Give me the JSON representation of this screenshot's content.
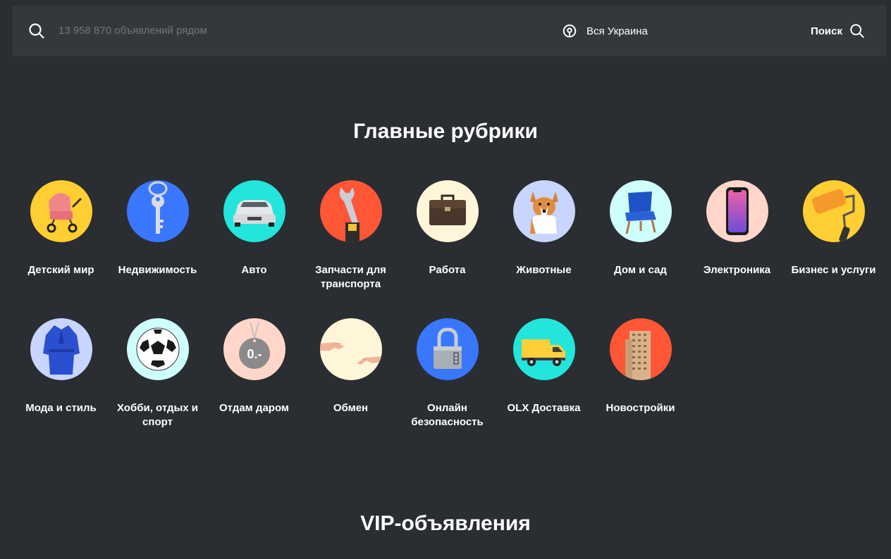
{
  "search": {
    "placeholder": "13 958 870 объявлений рядом",
    "location": "Вся Украина",
    "button_label": "Поиск",
    "icon": "search-icon",
    "location_icon": "map-pin-icon"
  },
  "main_title": "Главные рубрики",
  "vip_title": "VIP-объявления",
  "categories": [
    {
      "label": "Детский мир",
      "icon": "baby-stroller-icon",
      "bg": "#ffce32"
    },
    {
      "label": "Недвижимость",
      "icon": "key-icon",
      "bg": "#3a77ff"
    },
    {
      "label": "Авто",
      "icon": "car-icon",
      "bg": "#23e5db"
    },
    {
      "label": "Запчасти для транспорта",
      "icon": "wrench-icon",
      "bg": "#ff5636"
    },
    {
      "label": "Работа",
      "icon": "briefcase-icon",
      "bg": "#fff6d9"
    },
    {
      "label": "Животные",
      "icon": "dog-icon",
      "bg": "#c8d5ff"
    },
    {
      "label": "Дом и сад",
      "icon": "chair-icon",
      "bg": "#cefffd"
    },
    {
      "label": "Электроника",
      "icon": "smartphone-icon",
      "bg": "#ffd6c9"
    },
    {
      "label": "Бизнес и услуги",
      "icon": "paint-roller-icon",
      "bg": "#ffce32"
    },
    {
      "label": "Мода и стиль",
      "icon": "robe-icon",
      "bg": "#c8d5ff"
    },
    {
      "label": "Хобби, отдых и спорт",
      "icon": "soccer-ball-icon",
      "bg": "#cefffd"
    },
    {
      "label": "Отдам даром",
      "icon": "free-tag-icon",
      "bg": "#ffd6c9"
    },
    {
      "label": "Обмен",
      "icon": "handshake-icon",
      "bg": "#fff6d9"
    },
    {
      "label": "Онлайн безопасность",
      "icon": "padlock-icon",
      "bg": "#3a77ff"
    },
    {
      "label": "OLX Доставка",
      "icon": "delivery-truck-icon",
      "bg": "#23e5db"
    },
    {
      "label": "Новостройки",
      "icon": "building-icon",
      "bg": "#ff5636"
    }
  ],
  "category_sample_text": "0.-"
}
